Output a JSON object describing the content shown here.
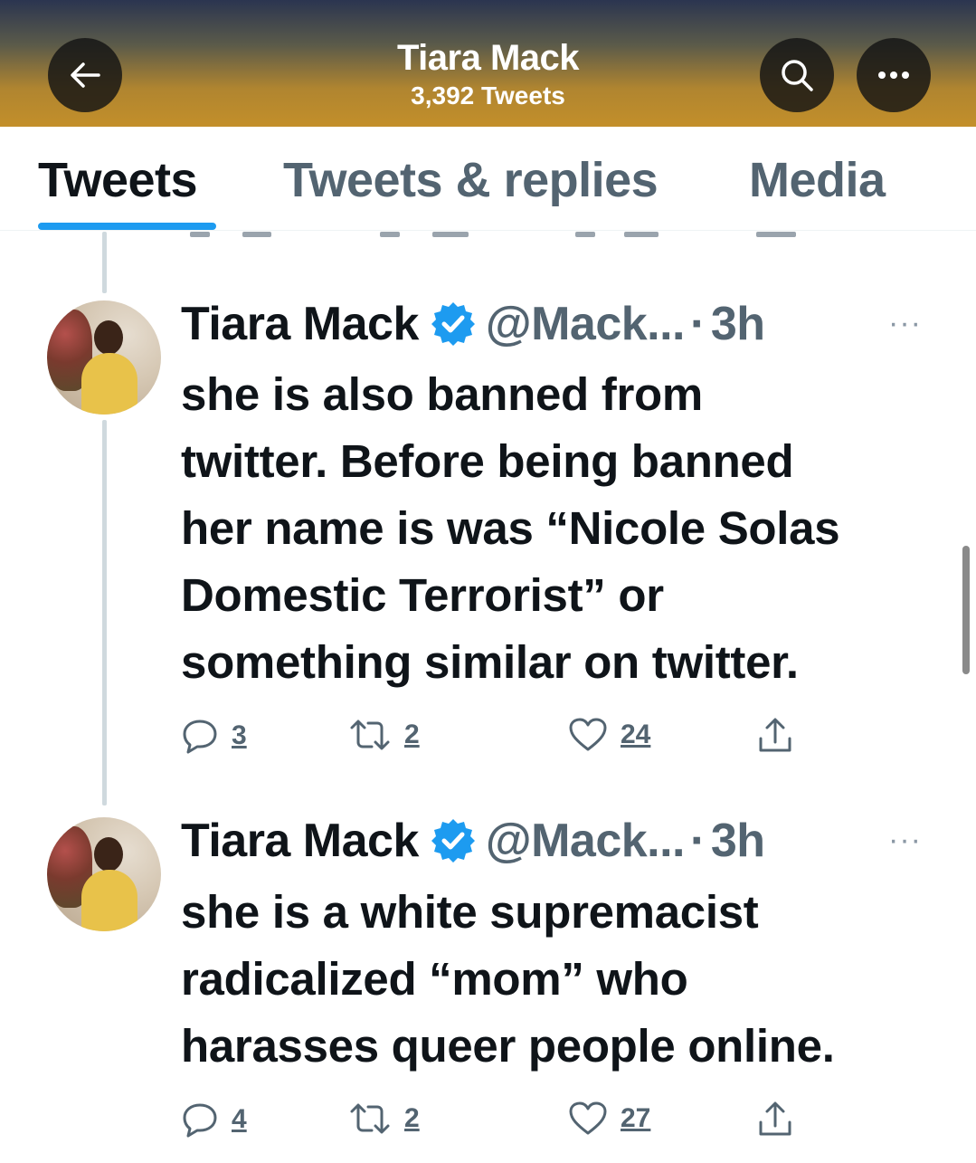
{
  "header": {
    "title": "Tiara Mack",
    "subtitle": "3,392 Tweets",
    "back_icon": "arrow-left-icon",
    "search_icon": "search-icon",
    "more_icon": "more-horizontal-icon"
  },
  "tabs": [
    {
      "label": "Tweets",
      "active": true
    },
    {
      "label": "Tweets & replies",
      "active": false
    },
    {
      "label": "Media",
      "active": false
    }
  ],
  "tweets": [
    {
      "name": "Tiara Mack",
      "handle": "@Mack...",
      "dot": "·",
      "time": "3h",
      "more": "···",
      "lines": [
        "she is also banned from",
        "twitter. Before being banned",
        "her name is was “Nicole Solas",
        "Domestic Terrorist” or",
        "something similar on twitter."
      ],
      "replies": "3",
      "retweets": "2",
      "likes": "24"
    },
    {
      "name": "Tiara Mack",
      "handle": "@Mack...",
      "dot": "·",
      "time": "3h",
      "more": "···",
      "lines": [
        "she is a white supremacist",
        "radicalized “mom” who",
        "harasses queer people online."
      ],
      "replies": "4",
      "retweets": "2",
      "likes": "27"
    }
  ],
  "colors": {
    "accent": "#1d9bf0",
    "verified": "#1d9bf0",
    "secondary_text": "#536471",
    "primary_text": "#0f1419"
  }
}
